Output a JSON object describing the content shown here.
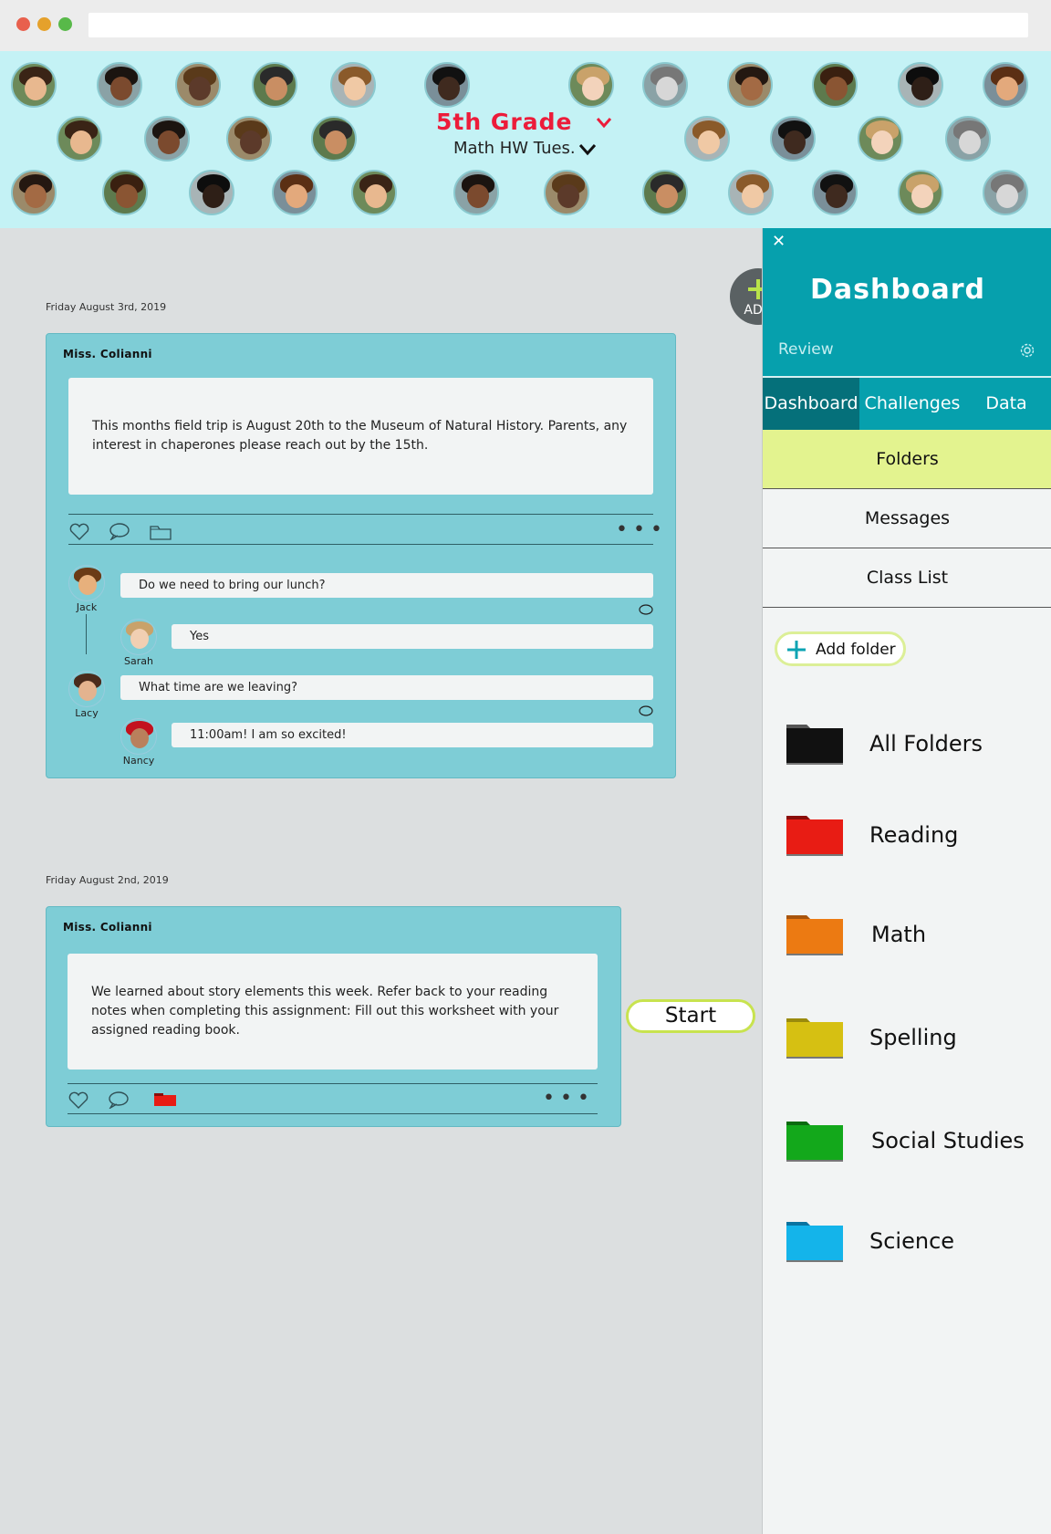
{
  "browser": {
    "dots": [
      "#e8604d",
      "#e5a12b",
      "#58b949"
    ]
  },
  "header": {
    "grade_title": "5th Grade",
    "assignment": "Math  HW Tues.",
    "colors": {
      "background": "#c4f2f5",
      "title": "#ec1c3a"
    }
  },
  "fab": {
    "label": "ADD",
    "icon": "plus-icon"
  },
  "posts": [
    {
      "date": "Friday August 3rd, 2019",
      "author": "Miss. Colianni",
      "body": "This months field trip is August 20th to the  Museum of  Natural  History.  Parents, any interest in chaperones please reach out by the 15th.",
      "comments": [
        {
          "name": "Jack",
          "text": "Do we need to bring our lunch?"
        },
        {
          "name": "Sarah",
          "text": "Yes"
        },
        {
          "name": "Lacy",
          "text": "What time are we leaving?"
        },
        {
          "name": "Nancy",
          "text": "11:00am!  I am so excited!"
        }
      ]
    },
    {
      "date": "Friday August 2nd, 2019",
      "author": "Miss. Colianni",
      "body": "We learned about story elements this week.  Refer back to your reading notes when completing this assignment:  Fill out this worksheet with your assigned reading book.",
      "action": "Start"
    }
  ],
  "panel": {
    "close": "✕",
    "title": "Dashboard",
    "review": "Review",
    "tabs": [
      "Dashboard",
      "Challenges",
      "Data"
    ],
    "menu": [
      "Folders",
      "Messages",
      "Class List"
    ],
    "add_folder": "Add folder",
    "folders": [
      {
        "name": "All Folders",
        "color": "#111111",
        "tab": "#555555"
      },
      {
        "name": "Reading",
        "color": "#e81c14",
        "tab": "#8a0e0a"
      },
      {
        "name": "Math",
        "color": "#ec7a12",
        "tab": "#a8540c"
      },
      {
        "name": "Spelling",
        "color": "#d6c012",
        "tab": "#9a8a0c"
      },
      {
        "name": "Social Studies",
        "color": "#13a81b",
        "tab": "#0b6b10"
      },
      {
        "name": "Science",
        "color": "#14b4ea",
        "tab": "#0a73a0"
      }
    ]
  }
}
